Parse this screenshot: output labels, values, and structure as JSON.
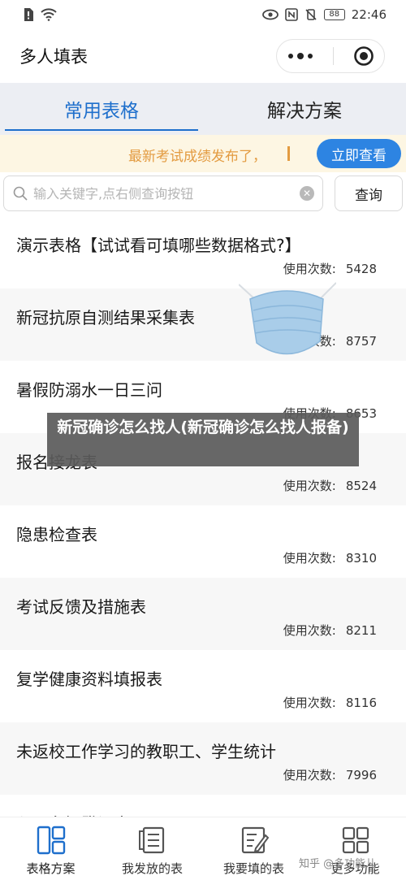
{
  "status": {
    "time": "22:46",
    "battery": "88"
  },
  "nav": {
    "title": "多人填表",
    "more_icon": "more-dots-icon",
    "close_icon": "target-icon"
  },
  "tabs": [
    {
      "label": "常用表格",
      "active": true
    },
    {
      "label": "解决方案",
      "active": false
    }
  ],
  "notice": {
    "text": "最新考试成绩发布了，",
    "button": "立即查看"
  },
  "search": {
    "placeholder": "输入关键字,点右侧查询按钮",
    "button": "查询"
  },
  "list": {
    "count_label": "使用次数:",
    "items": [
      {
        "title": "演示表格【试试看可填哪些数据格式?】",
        "count": "5428"
      },
      {
        "title": "新冠抗原自测结果采集表",
        "count": "8757"
      },
      {
        "title": "暑假防溺水一日三问",
        "count": "8653"
      },
      {
        "title": "报名接龙表",
        "count": "8524"
      },
      {
        "title": "隐患检查表",
        "count": "8310"
      },
      {
        "title": "考试反馈及措施表",
        "count": "8211"
      },
      {
        "title": "复学健康资料填报表",
        "count": "8116"
      },
      {
        "title": "未返校工作学习的教职工、学生统计",
        "count": "7996"
      },
      {
        "title": "入厂车辆登记表",
        "count": ""
      }
    ]
  },
  "overlay": {
    "text": "新冠确诊怎么找人(新冠确诊怎么找人报备)"
  },
  "bottom_nav": [
    {
      "label": "表格方案",
      "icon": "grid-table-icon",
      "active": true
    },
    {
      "label": "我发放的表",
      "icon": "document-list-icon",
      "active": false
    },
    {
      "label": "我要填的表",
      "icon": "edit-form-icon",
      "active": false
    },
    {
      "label": "更多功能",
      "icon": "apps-grid-icon",
      "active": false
    }
  ],
  "watermark": "知乎 @多功能儿",
  "colors": {
    "accent": "#1e6fcc",
    "notice_bg": "#fdf6e3",
    "notice_text": "#e39b41",
    "button_blue": "#2d84e2"
  }
}
